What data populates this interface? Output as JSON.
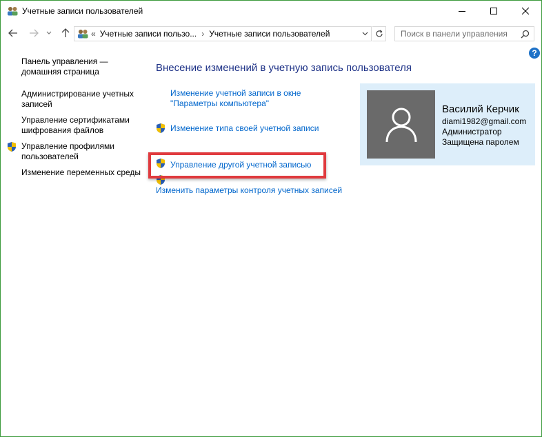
{
  "window": {
    "title": "Учетные записи пользователей",
    "controls": {
      "minimize": "minimize",
      "maximize": "maximize",
      "close": "close"
    }
  },
  "address": {
    "overflow": "«",
    "crumbs": [
      "Учетные записи пользо...",
      "Учетные записи пользователей"
    ],
    "separator": "›"
  },
  "search": {
    "placeholder": "Поиск в панели управления"
  },
  "help": {
    "label": "?"
  },
  "sidebar": {
    "items": [
      {
        "label": "Панель управления — домашняя страница",
        "shield": false
      },
      {
        "label": "Администрирование учетных записей",
        "shield": false
      },
      {
        "label": "Управление сертификатами шифрования файлов",
        "shield": false
      },
      {
        "label": "Управление профилями пользователей",
        "shield": true
      },
      {
        "label": "Изменение переменных среды",
        "shield": false
      }
    ]
  },
  "main": {
    "title": "Внесение изменений в учетную запись пользователя",
    "links": [
      {
        "label_line1": "Изменение учетной записи в окне",
        "label_line2": "\"Параметры компьютера\"",
        "shield": false
      },
      {
        "label": "Изменение типа своей учетной записи",
        "shield": true
      },
      {
        "label": "Управление другой учетной записью",
        "shield": true,
        "highlighted": true
      },
      {
        "label": "Изменить параметры контроля учетных записей",
        "shield": true
      }
    ]
  },
  "user": {
    "name": "Василий Керчик",
    "email": "diami1982@gmail.com",
    "role": "Администратор",
    "password_status": "Защищена паролем",
    "avatar_icon": "user-silhouette-icon"
  },
  "colors": {
    "window_border": "#3c9a3c",
    "link": "#0066cc",
    "heading": "#1e3287",
    "highlight": "#e03a3e",
    "card_bg": "#ddeefa",
    "avatar_bg": "#6a6a6a"
  }
}
